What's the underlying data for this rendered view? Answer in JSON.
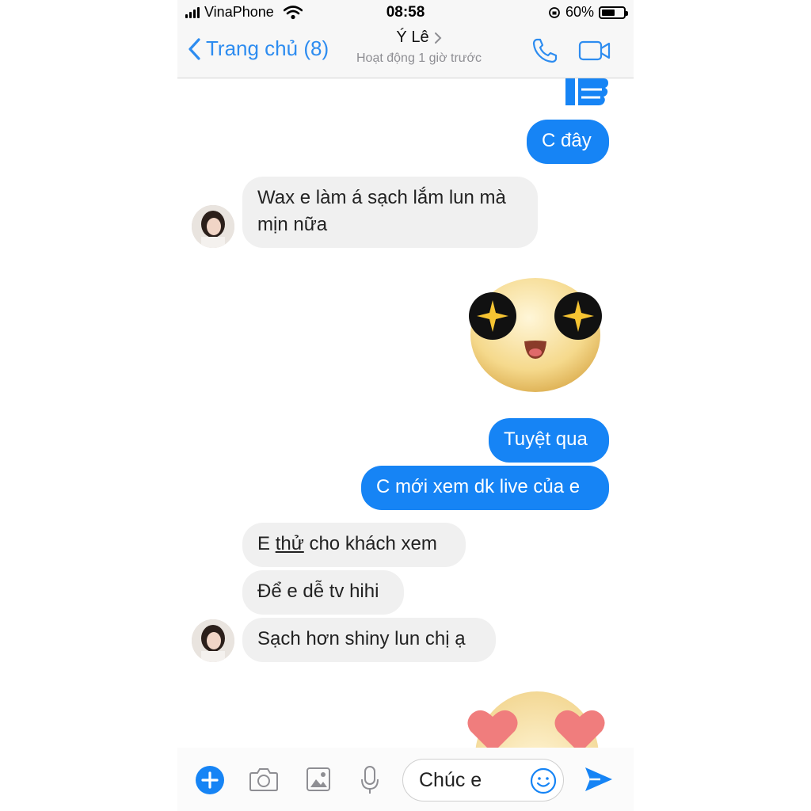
{
  "status_bar": {
    "carrier": "VinaPhone",
    "time": "08:58",
    "battery_percent": "60%",
    "battery_level": 0.6
  },
  "header": {
    "back_label": "Trang chủ (8)",
    "contact_name": "Ý Lê",
    "active_status": "Hoạt động 1 giờ trước"
  },
  "messages": [
    {
      "type": "sticker",
      "from": "me",
      "sticker": "thumbs-up-icon"
    },
    {
      "type": "text",
      "from": "me",
      "text": "C đây"
    },
    {
      "type": "text",
      "from": "them",
      "lines": [
        "Wax e làm á sạch lắm lun mà",
        "mịn nữa"
      ]
    },
    {
      "type": "sticker",
      "from": "me",
      "sticker": "star-eyes-emoji"
    },
    {
      "type": "text",
      "from": "me",
      "text": "Tuyệt qua"
    },
    {
      "type": "text",
      "from": "me",
      "text": "C mới xem dk live của e"
    },
    {
      "type": "text",
      "from": "them",
      "text_before": "E ",
      "underlined": "thử",
      "text_after": " cho khách xem"
    },
    {
      "type": "text",
      "from": "them",
      "text": "Để e dễ tv hihi"
    },
    {
      "type": "text",
      "from": "them",
      "text": "Sạch hơn shiny lun chị ạ"
    },
    {
      "type": "sticker",
      "from": "me",
      "sticker": "heart-eyes-emoji"
    }
  ],
  "composer": {
    "input_value": "Chúc e"
  },
  "colors": {
    "accent": "#2d8cf0",
    "outgoing_bubble": "#1684f5",
    "incoming_bubble": "#f0f0f0"
  }
}
